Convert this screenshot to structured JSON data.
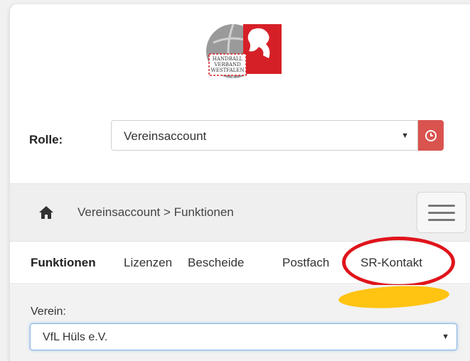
{
  "logo": {
    "text_lines": [
      "HANDBALL",
      "VERBAND",
      "WESTFALEN"
    ]
  },
  "role": {
    "label": "Rolle:",
    "selected": "Vereinsaccount",
    "button_icon": "clock-icon",
    "button_color": "#d9534f"
  },
  "breadcrumb": {
    "icon": "home-icon",
    "text": "Vereinsaccount > Funktionen",
    "menu_icon": "hamburger-menu-icon"
  },
  "tabs": [
    {
      "label": "Funktionen",
      "active": true
    },
    {
      "label": "Lizenzen",
      "active": false
    },
    {
      "label": "Bescheide",
      "active": false
    },
    {
      "label": "Postfach",
      "active": false
    },
    {
      "label": "SR-Kontakt",
      "active": false
    }
  ],
  "annotations": {
    "circle_color": "#e0141b",
    "highlight_color": "#ffc312"
  },
  "verein": {
    "label": "Verein:",
    "selected": "VfL Hüls e.V."
  }
}
